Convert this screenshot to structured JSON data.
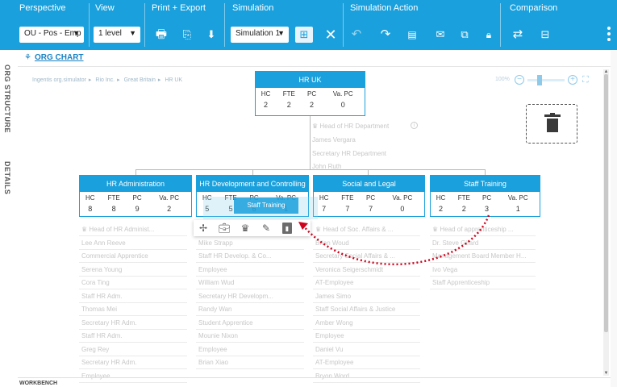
{
  "toolbar": {
    "perspective_label": "Perspective",
    "perspective_value": "OU - Pos - Emp",
    "view_label": "View",
    "view_value": "1 level",
    "print_export_label": "Print + Export",
    "simulation_label": "Simulation",
    "simulation_value": "Simulation 1",
    "simulation_action_label": "Simulation Action",
    "comparison_label": "Comparison"
  },
  "sidebar": {
    "org_structure_label": "ORG STRUCTURE",
    "details_label": "DETAILS"
  },
  "header": {
    "title": "ORG CHART"
  },
  "breadcrumb": [
    "Ingentis org.simulator",
    "Rio Inc.",
    "Great Britain",
    "HR UK"
  ],
  "zoom": {
    "label": "100%",
    "level_percent": 30
  },
  "columns": [
    "HC",
    "FTE",
    "PC",
    "Va. PC"
  ],
  "root_unit": {
    "title": "HR UK",
    "values": [
      "2",
      "2",
      "2",
      "0"
    ],
    "members": [
      "Head of HR Department",
      "James Vergara",
      "Secretary HR Department",
      "John Ruth"
    ]
  },
  "units": [
    {
      "title": "HR Administration",
      "values": [
        "8",
        "8",
        "9",
        "2"
      ],
      "members": [
        "Head of HR Administ...",
        "Lee Ann Reeve",
        "Commercial Apprentice",
        "Serena Young",
        "Cora Ting",
        "Staff HR Adm.",
        "Thomas Mei",
        "Secretary HR Adm.",
        "Staff HR Adm.",
        "Greg Rey",
        "Secretary HR Adm.",
        "Employee"
      ]
    },
    {
      "title": "HR Development and Controlling",
      "values": [
        "5",
        "5",
        "6",
        "1"
      ],
      "members": [
        "Head of HR Developm...",
        "Mike Strapp",
        "Staff HR Develop. & Co...",
        "Employee",
        "William Wud",
        "Secretary HR Developm...",
        "Randy Wan",
        "Student Apprentice",
        "Mounie Nixon",
        "Employee",
        "Brian Xiao"
      ]
    },
    {
      "title": "Social and Legal",
      "values": [
        "7",
        "7",
        "7",
        "0"
      ],
      "members": [
        "Head of Soc. Affairs & ...",
        "Brian Woud",
        "Secretary Social Affairs & ...",
        "Veronica Seigerschmidt",
        "AT-Employee",
        "James Simo",
        "Staff Social Affairs & Justice",
        "Amber Wong",
        "Employee",
        "Daniel Vu",
        "AT-Employee",
        "Bryon Word"
      ]
    },
    {
      "title": "Staff Training",
      "values": [
        "2",
        "2",
        "3",
        "1"
      ],
      "members": [
        "Head of apprenticeship ...",
        "Dr. Steve Girard",
        "Management Board Member H...",
        "Ivo Vega",
        "Staff Apprenticeship"
      ]
    }
  ],
  "drag_ghost": {
    "label": "Staff Training"
  },
  "workbench_label": "WORKBENCH",
  "colors": {
    "accent": "#1aa0dc",
    "drag_path": "#d0021b"
  }
}
